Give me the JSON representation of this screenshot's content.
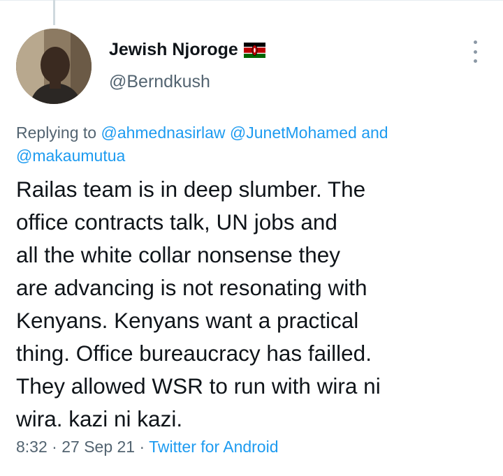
{
  "tweet": {
    "author": {
      "display_name": "Jewish Njoroge",
      "flag_icon": "kenya-flag-icon",
      "handle": "@Berndkush"
    },
    "more_icon": "more-vertical-icon",
    "replying_to": {
      "prefix": "Replying to",
      "mentions": [
        "@ahmednasirlaw",
        "@JunetMohamed",
        "@makaumutua"
      ],
      "conjunction": "and"
    },
    "text": "Railas team is in deep slumber. The\noffice contracts talk, UN jobs and\nall the white collar nonsense they\nare advancing is not resonating with\nKenyans. Kenyans want a practical\nthing. Office bureaucracy has failled.\nThey allowed WSR to run with wira ni\nwira. kazi ni kazi.",
    "time": "8:32",
    "separator": "·",
    "date": "27 Sep 21",
    "source": "Twitter for Android"
  },
  "colors": {
    "link": "#1d9bf0",
    "secondary_text": "#536471",
    "primary_text": "#0f1419"
  }
}
